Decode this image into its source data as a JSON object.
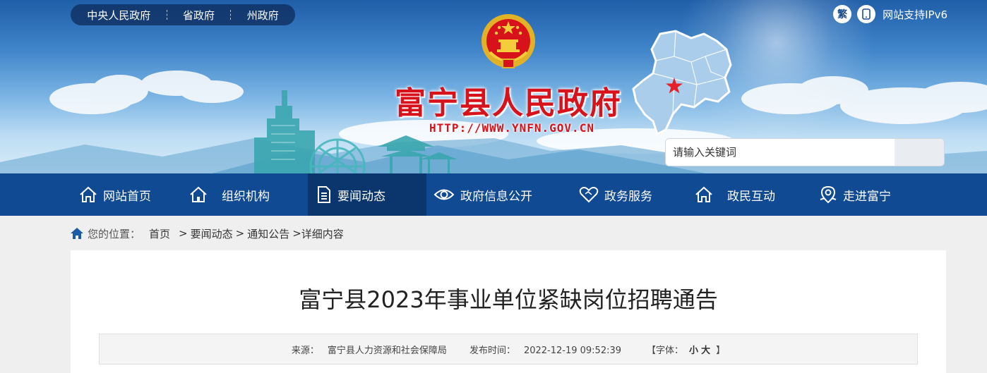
{
  "top_links": [
    "中央人民政府",
    "省政府",
    "州政府"
  ],
  "top_right": {
    "traditional": "繁",
    "ipv6_text": "网站支持IPv6"
  },
  "site": {
    "title": "富宁县人民政府",
    "url": "HTTP://WWW.YNFN.GOV.CN"
  },
  "search": {
    "placeholder": "请输入关键词"
  },
  "nav": [
    {
      "label": "网站首页",
      "icon": "home-icon"
    },
    {
      "label": "组织机构",
      "icon": "building-icon"
    },
    {
      "label": "要闻动态",
      "icon": "document-icon",
      "active": true
    },
    {
      "label": "政府信息公开",
      "icon": "eye-icon"
    },
    {
      "label": "政务服务",
      "icon": "heart-icon"
    },
    {
      "label": "政民互动",
      "icon": "house-icon"
    },
    {
      "label": "走进富宁",
      "icon": "location-icon"
    }
  ],
  "breadcrumb": {
    "label": "您的位置：",
    "items": [
      "首页",
      "要闻动态",
      "通知公告",
      "详细内容"
    ]
  },
  "article": {
    "title": "富宁县2023年事业单位紧缺岗位招聘通告",
    "source_label": "来源：",
    "source": "富宁县人力资源和社会保障局",
    "time_label": "发布时间：",
    "time": "2022-12-19 09:52:39",
    "font_label": "【字体：",
    "font_small": "小",
    "font_large": "大",
    "font_end": "】"
  },
  "colors": {
    "nav_bg": "#0f4a92",
    "nav_active": "#0a356d",
    "title_red": "#d8121a"
  }
}
